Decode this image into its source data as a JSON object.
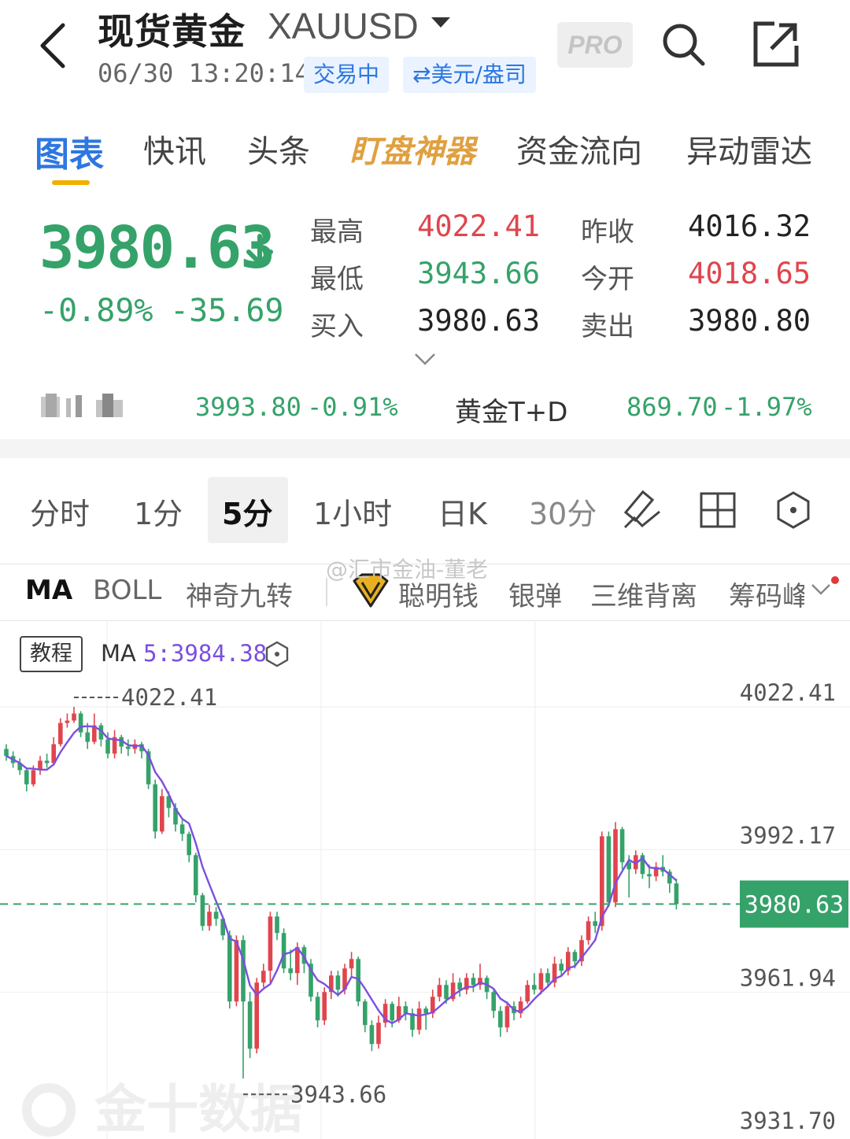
{
  "header": {
    "title": "现货黄金",
    "code": "XAUUSD",
    "timestamp": "06/30 13:20:14",
    "status_badge": "交易中",
    "unit_badge": "⇄美元/盎司",
    "pro_label": "PRO"
  },
  "tabs": [
    "图表",
    "快讯",
    "头条",
    "盯盘神器",
    "资金流向",
    "异动雷达"
  ],
  "quote": {
    "price": "3980.63",
    "change_pct": "-0.89%",
    "change_abs": "-35.69",
    "stats": {
      "high_label": "最高",
      "high": "4022.41",
      "prev_close_label": "昨收",
      "prev_close": "4016.32",
      "low_label": "最低",
      "low": "3943.66",
      "open_label": "今开",
      "open": "4018.65",
      "bid_label": "买入",
      "bid": "3980.63",
      "ask_label": "卖出",
      "ask": "3980.80"
    }
  },
  "related": {
    "item1": {
      "price": "3993.80",
      "pct": "-0.91%"
    },
    "item2": {
      "name": "黄金T+D",
      "price": "869.70",
      "pct": "-1.97%"
    }
  },
  "periods": [
    "分时",
    "1分",
    "5分",
    "1小时",
    "日K",
    "30分"
  ],
  "active_period": "5分",
  "indicators": [
    "MA",
    "BOLL",
    "神奇九转",
    "聪明钱",
    "银弹",
    "三维背离",
    "筹码峰"
  ],
  "watermark": "@汇市金油-董老",
  "chart": {
    "tutorial_label": "教程",
    "ma_label": "MA",
    "ma_value": "5:3984.38",
    "brand_watermark": "金十数据"
  },
  "colors": {
    "up": "#e0454e",
    "down": "#35a26a",
    "accent": "#2d77e0",
    "ma": "#7b4fe0"
  },
  "chart_data": {
    "type": "candlestick",
    "y_ticks": [
      "4022.41",
      "3992.17",
      "3980.63",
      "3961.94",
      "3931.70"
    ],
    "high_marker": "4022.41",
    "low_marker": "3943.66",
    "current_price_tag": "3980.63",
    "candles": [
      {
        "o": 4013.5,
        "c": 4012.0,
        "h": 4014.5,
        "l": 4011.0
      },
      {
        "o": 4012.0,
        "c": 4010.5,
        "h": 4013.0,
        "l": 4009.5
      },
      {
        "o": 4010.5,
        "c": 4009.0,
        "h": 4011.5,
        "l": 4008.0
      },
      {
        "o": 4009.0,
        "c": 4006.0,
        "h": 4009.5,
        "l": 4004.5
      },
      {
        "o": 4006.0,
        "c": 4009.0,
        "h": 4010.0,
        "l": 4005.5
      },
      {
        "o": 4009.0,
        "c": 4011.0,
        "h": 4012.0,
        "l": 4008.0
      },
      {
        "o": 4011.0,
        "c": 4010.5,
        "h": 4012.5,
        "l": 4009.5
      },
      {
        "o": 4010.5,
        "c": 4014.5,
        "h": 4016.0,
        "l": 4010.0
      },
      {
        "o": 4014.5,
        "c": 4019.0,
        "h": 4020.0,
        "l": 4014.0
      },
      {
        "o": 4019.0,
        "c": 4019.5,
        "h": 4021.0,
        "l": 4018.0
      },
      {
        "o": 4019.5,
        "c": 4021.0,
        "h": 4022.41,
        "l": 4019.0
      },
      {
        "o": 4021.0,
        "c": 4017.0,
        "h": 4021.5,
        "l": 4016.0
      },
      {
        "o": 4017.0,
        "c": 4015.0,
        "h": 4019.0,
        "l": 4013.5
      },
      {
        "o": 4015.0,
        "c": 4018.5,
        "h": 4021.0,
        "l": 4014.5
      },
      {
        "o": 4018.5,
        "c": 4015.5,
        "h": 4019.0,
        "l": 4014.0
      },
      {
        "o": 4015.5,
        "c": 4012.5,
        "h": 4017.0,
        "l": 4011.5
      },
      {
        "o": 4012.5,
        "c": 4016.0,
        "h": 4017.5,
        "l": 4011.5
      },
      {
        "o": 4016.0,
        "c": 4014.0,
        "h": 4016.5,
        "l": 4012.5
      },
      {
        "o": 4014.0,
        "c": 4013.5,
        "h": 4015.5,
        "l": 4012.0
      },
      {
        "o": 4013.5,
        "c": 4014.5,
        "h": 4015.5,
        "l": 4012.5
      },
      {
        "o": 4014.5,
        "c": 4013.0,
        "h": 4015.0,
        "l": 4011.5
      },
      {
        "o": 4013.0,
        "c": 4006.0,
        "h": 4013.5,
        "l": 4005.0
      },
      {
        "o": 4006.0,
        "c": 3996.0,
        "h": 4007.0,
        "l": 3994.5
      },
      {
        "o": 3996.0,
        "c": 4003.5,
        "h": 4005.0,
        "l": 3995.5
      },
      {
        "o": 4003.5,
        "c": 4001.0,
        "h": 4004.5,
        "l": 3999.0
      },
      {
        "o": 4001.0,
        "c": 3997.5,
        "h": 4002.0,
        "l": 3996.0
      },
      {
        "o": 3997.5,
        "c": 3995.5,
        "h": 3998.5,
        "l": 3994.0
      },
      {
        "o": 3995.5,
        "c": 3991.0,
        "h": 3996.0,
        "l": 3989.5
      },
      {
        "o": 3991.0,
        "c": 3982.5,
        "h": 3991.5,
        "l": 3981.0
      },
      {
        "o": 3982.5,
        "c": 3976.0,
        "h": 3983.0,
        "l": 3975.0
      },
      {
        "o": 3976.0,
        "c": 3979.0,
        "h": 3980.5,
        "l": 3975.0
      },
      {
        "o": 3979.0,
        "c": 3977.5,
        "h": 3980.0,
        "l": 3976.0
      },
      {
        "o": 3977.5,
        "c": 3974.0,
        "h": 3978.0,
        "l": 3973.0
      },
      {
        "o": 3974.0,
        "c": 3960.0,
        "h": 3975.0,
        "l": 3958.5
      },
      {
        "o": 3960.0,
        "c": 3973.0,
        "h": 3974.0,
        "l": 3959.0
      },
      {
        "o": 3973.0,
        "c": 3960.0,
        "h": 3974.0,
        "l": 3943.66
      },
      {
        "o": 3960.0,
        "c": 3950.0,
        "h": 3962.0,
        "l": 3948.0
      },
      {
        "o": 3950.0,
        "c": 3964.0,
        "h": 3965.0,
        "l": 3949.0
      },
      {
        "o": 3964.0,
        "c": 3966.5,
        "h": 3968.0,
        "l": 3963.0
      },
      {
        "o": 3966.5,
        "c": 3978.0,
        "h": 3979.0,
        "l": 3964.0
      },
      {
        "o": 3978.0,
        "c": 3974.5,
        "h": 3979.0,
        "l": 3973.0
      },
      {
        "o": 3974.5,
        "c": 3967.0,
        "h": 3975.5,
        "l": 3966.0
      },
      {
        "o": 3967.0,
        "c": 3966.0,
        "h": 3971.0,
        "l": 3964.5
      },
      {
        "o": 3966.0,
        "c": 3971.5,
        "h": 3972.5,
        "l": 3963.5
      },
      {
        "o": 3971.5,
        "c": 3968.0,
        "h": 3972.0,
        "l": 3966.0
      },
      {
        "o": 3968.0,
        "c": 3961.0,
        "h": 3969.0,
        "l": 3960.0
      },
      {
        "o": 3961.0,
        "c": 3956.0,
        "h": 3962.0,
        "l": 3954.5
      },
      {
        "o": 3956.0,
        "c": 3962.0,
        "h": 3963.0,
        "l": 3955.0
      },
      {
        "o": 3962.0,
        "c": 3965.5,
        "h": 3966.5,
        "l": 3960.5
      },
      {
        "o": 3965.5,
        "c": 3962.5,
        "h": 3966.5,
        "l": 3961.0
      },
      {
        "o": 3962.5,
        "c": 3967.0,
        "h": 3968.0,
        "l": 3961.5
      },
      {
        "o": 3967.0,
        "c": 3969.0,
        "h": 3970.5,
        "l": 3965.0
      },
      {
        "o": 3969.0,
        "c": 3960.0,
        "h": 3969.5,
        "l": 3959.0
      },
      {
        "o": 3960.0,
        "c": 3955.0,
        "h": 3960.5,
        "l": 3953.5
      },
      {
        "o": 3955.0,
        "c": 3951.0,
        "h": 3956.0,
        "l": 3949.5
      },
      {
        "o": 3951.0,
        "c": 3955.5,
        "h": 3957.0,
        "l": 3950.0
      },
      {
        "o": 3955.5,
        "c": 3959.5,
        "h": 3960.5,
        "l": 3954.5
      },
      {
        "o": 3959.5,
        "c": 3956.0,
        "h": 3960.0,
        "l": 3954.5
      },
      {
        "o": 3956.0,
        "c": 3959.0,
        "h": 3961.0,
        "l": 3955.5
      },
      {
        "o": 3959.0,
        "c": 3957.5,
        "h": 3960.0,
        "l": 3956.0
      },
      {
        "o": 3957.5,
        "c": 3954.0,
        "h": 3958.5,
        "l": 3952.5
      },
      {
        "o": 3954.0,
        "c": 3958.5,
        "h": 3960.0,
        "l": 3953.0
      },
      {
        "o": 3958.5,
        "c": 3957.5,
        "h": 3959.0,
        "l": 3954.0
      },
      {
        "o": 3957.5,
        "c": 3961.0,
        "h": 3962.5,
        "l": 3956.5
      },
      {
        "o": 3961.0,
        "c": 3963.5,
        "h": 3965.0,
        "l": 3960.0
      },
      {
        "o": 3963.5,
        "c": 3960.5,
        "h": 3964.5,
        "l": 3959.5
      },
      {
        "o": 3960.5,
        "c": 3964.0,
        "h": 3966.0,
        "l": 3960.0
      },
      {
        "o": 3964.0,
        "c": 3962.5,
        "h": 3965.0,
        "l": 3961.0
      },
      {
        "o": 3962.5,
        "c": 3965.0,
        "h": 3966.0,
        "l": 3961.5
      },
      {
        "o": 3965.0,
        "c": 3963.5,
        "h": 3966.0,
        "l": 3962.0
      },
      {
        "o": 3963.5,
        "c": 3965.0,
        "h": 3968.0,
        "l": 3962.5
      },
      {
        "o": 3965.0,
        "c": 3962.0,
        "h": 3965.5,
        "l": 3960.5
      },
      {
        "o": 3962.0,
        "c": 3958.0,
        "h": 3962.5,
        "l": 3956.5
      },
      {
        "o": 3958.0,
        "c": 3954.5,
        "h": 3959.0,
        "l": 3952.5
      },
      {
        "o": 3954.5,
        "c": 3959.0,
        "h": 3960.0,
        "l": 3953.5
      },
      {
        "o": 3959.0,
        "c": 3957.5,
        "h": 3960.0,
        "l": 3956.0
      },
      {
        "o": 3957.5,
        "c": 3960.0,
        "h": 3961.0,
        "l": 3956.5
      },
      {
        "o": 3960.0,
        "c": 3963.5,
        "h": 3964.5,
        "l": 3959.5
      },
      {
        "o": 3963.5,
        "c": 3962.5,
        "h": 3966.0,
        "l": 3961.5
      },
      {
        "o": 3962.5,
        "c": 3966.0,
        "h": 3967.0,
        "l": 3961.5
      },
      {
        "o": 3966.0,
        "c": 3964.0,
        "h": 3967.0,
        "l": 3963.0
      },
      {
        "o": 3964.0,
        "c": 3968.0,
        "h": 3969.5,
        "l": 3963.0
      },
      {
        "o": 3968.0,
        "c": 3966.5,
        "h": 3969.0,
        "l": 3965.5
      },
      {
        "o": 3966.5,
        "c": 3970.5,
        "h": 3971.5,
        "l": 3965.5
      },
      {
        "o": 3970.5,
        "c": 3968.5,
        "h": 3971.0,
        "l": 3967.0
      },
      {
        "o": 3968.5,
        "c": 3973.0,
        "h": 3974.0,
        "l": 3967.5
      },
      {
        "o": 3973.0,
        "c": 3977.0,
        "h": 3978.0,
        "l": 3972.0
      },
      {
        "o": 3977.0,
        "c": 3976.0,
        "h": 3979.0,
        "l": 3974.5
      },
      {
        "o": 3976.0,
        "c": 3995.0,
        "h": 3996.0,
        "l": 3975.0
      },
      {
        "o": 3995.0,
        "c": 3981.0,
        "h": 3996.0,
        "l": 3980.0
      },
      {
        "o": 3981.0,
        "c": 3996.5,
        "h": 3998.0,
        "l": 3980.0
      },
      {
        "o": 3996.5,
        "c": 3989.5,
        "h": 3997.0,
        "l": 3988.0
      },
      {
        "o": 3989.5,
        "c": 3988.0,
        "h": 3991.0,
        "l": 3982.0
      },
      {
        "o": 3988.0,
        "c": 3991.0,
        "h": 3992.0,
        "l": 3987.0
      },
      {
        "o": 3991.0,
        "c": 3987.0,
        "h": 3991.5,
        "l": 3986.0
      },
      {
        "o": 3987.0,
        "c": 3986.5,
        "h": 3989.0,
        "l": 3984.0
      },
      {
        "o": 3986.5,
        "c": 3988.5,
        "h": 3989.5,
        "l": 3985.5
      },
      {
        "o": 3988.5,
        "c": 3987.5,
        "h": 3991.0,
        "l": 3986.5
      },
      {
        "o": 3987.5,
        "c": 3985.0,
        "h": 3988.0,
        "l": 3983.0
      },
      {
        "o": 3985.0,
        "c": 3980.63,
        "h": 3986.0,
        "l": 3979.5
      }
    ]
  }
}
